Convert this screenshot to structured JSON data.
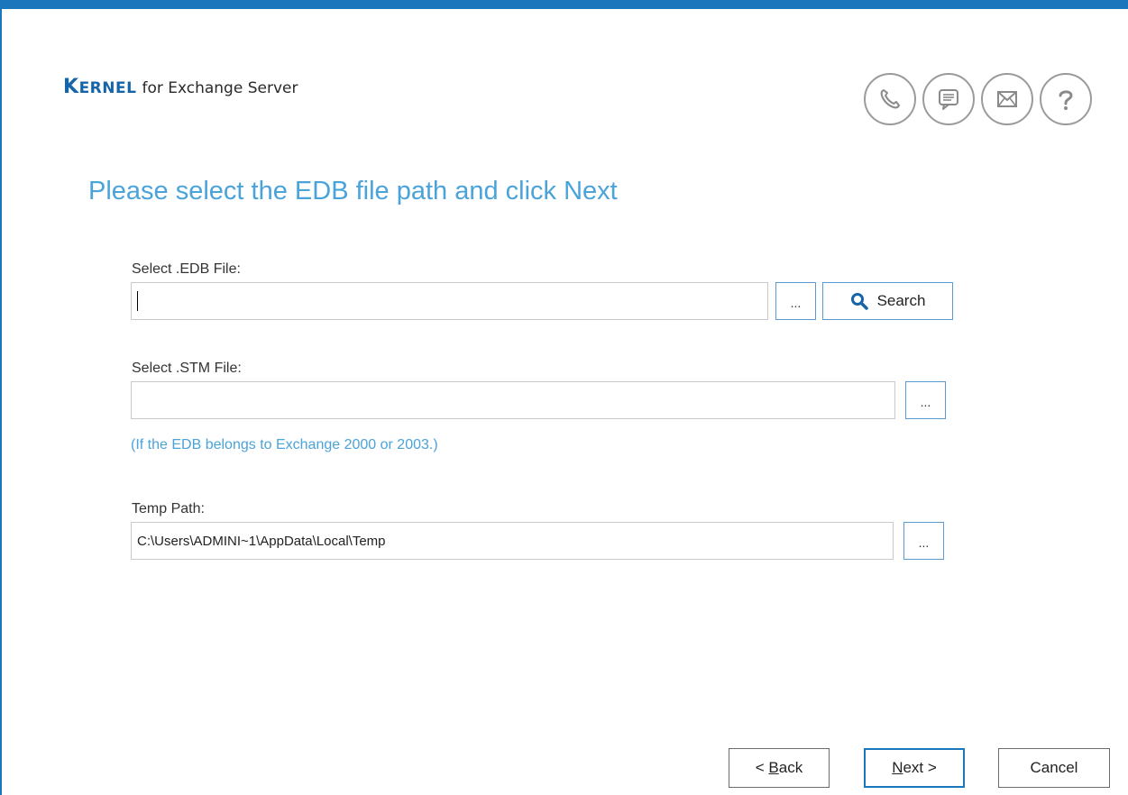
{
  "app": {
    "brand_logo_first": "K",
    "brand_logo_rest": "ERNEL",
    "brand_suffix": "for Exchange Server",
    "accent_color": "#1b76bc",
    "title_color": "#4aa3d9"
  },
  "help_icons": [
    "phone-icon",
    "chat-icon",
    "mail-icon",
    "help-icon"
  ],
  "page": {
    "title": "Please select the EDB file path and click Next"
  },
  "edb": {
    "label": "Select .EDB File:",
    "value": "",
    "browse_label": "...",
    "search_label": "Search"
  },
  "stm": {
    "label": "Select .STM File:",
    "value": "",
    "browse_label": "...",
    "note": "(If the EDB belongs to Exchange 2000 or 2003.)"
  },
  "temp": {
    "label": "Temp Path:",
    "value": "C:\\Users\\ADMINI~1\\AppData\\Local\\Temp",
    "browse_label": "..."
  },
  "nav": {
    "back_prefix": "< ",
    "back_mnemonic": "B",
    "back_rest": "ack",
    "next_mnemonic": "N",
    "next_rest": "ext >",
    "cancel_label": "Cancel"
  }
}
